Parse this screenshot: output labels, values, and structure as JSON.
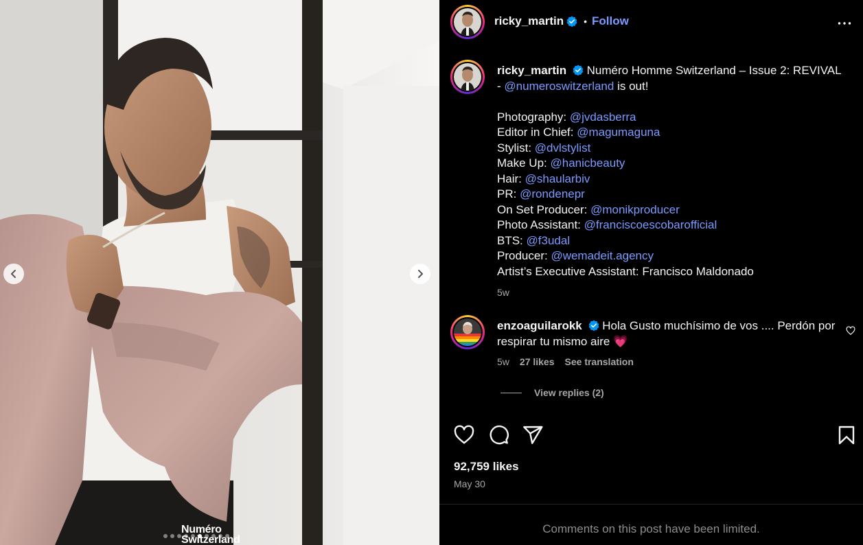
{
  "post": {
    "author": "ricky_martin",
    "follow_label": "Follow",
    "separator": "•",
    "caption": {
      "intro": "Numéro Homme Switzerland – Issue 2: REVIVAL -",
      "intro_mention": "@numeroswitzerland",
      "intro_tail": "is out!",
      "credits": [
        {
          "role": "Photography:",
          "handle": "@jvdasberra"
        },
        {
          "role": "Editor in Chief:",
          "handle": "@magumaguna"
        },
        {
          "role": "Stylist:",
          "handle": "@dvlstylist"
        },
        {
          "role": "Make Up:",
          "handle": "@hanicbeauty"
        },
        {
          "role": "Hair:",
          "handle": "@shaularbiv"
        },
        {
          "role": "PR:",
          "handle": "@rondenepr"
        },
        {
          "role": "On Set Producer:",
          "handle": "@monikproducer"
        },
        {
          "role": "Photo Assistant:",
          "handle": "@franciscoescobarofficial"
        },
        {
          "role": "BTS:",
          "handle": "@f3udal"
        },
        {
          "role": "Producer:",
          "handle": "@wemadeit.agency"
        }
      ],
      "last_line": "Artist’s Executive Assistant: Francisco Maldonado",
      "time": "5w"
    },
    "comment": {
      "author": "enzoaguilarokk",
      "text": "Hola Gusto muchísimo de vos .... Perdón por respirar tu mismo aire",
      "emoji": "💗",
      "time": "5w",
      "likes": "27 likes",
      "translate": "See translation",
      "view_replies": "View replies (2)"
    },
    "likes": "92,759 likes",
    "date": "May 30",
    "comments_limited": "Comments on this post have been limited."
  },
  "media": {
    "watermark_line1": "Numéro",
    "watermark_line2": "Switzerland",
    "carousel_dots": 10,
    "active_dot": 5
  },
  "icons": {
    "verified": "verified-badge-icon",
    "more": "more-options-icon",
    "like": "heart-icon",
    "comment": "comment-icon",
    "share": "share-icon",
    "save": "bookmark-icon",
    "prev": "chevron-left-icon",
    "next": "chevron-right-icon"
  },
  "colors": {
    "link": "#7a9bff",
    "verified": "#0095f6",
    "muted": "#a8a8a8"
  }
}
